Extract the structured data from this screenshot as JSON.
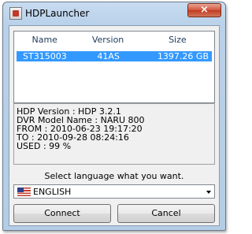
{
  "window": {
    "title": "HDPLauncher",
    "close_label": "×"
  },
  "list": {
    "columns": [
      "Name",
      "Version",
      "Size"
    ],
    "rows": [
      {
        "name": "ST315003",
        "version": "41AS",
        "size": "1397.26 GB",
        "selected": true
      }
    ]
  },
  "info": {
    "lines": [
      "HDP Version : HDP 3.2.1",
      "DVR Model Name : NARU 800",
      "FROM : 2010-06-23 19:17:20",
      "TO : 2010-09-28 08:24:16",
      "USED : 99 %"
    ]
  },
  "language": {
    "prompt": "Select language what you want.",
    "selected": "ENGLISH",
    "flag_icon": "us-flag-icon"
  },
  "buttons": {
    "connect": "Connect",
    "cancel": "Cancel"
  },
  "colors": {
    "selection": "#3399ff",
    "close_button": "#c13a20"
  }
}
